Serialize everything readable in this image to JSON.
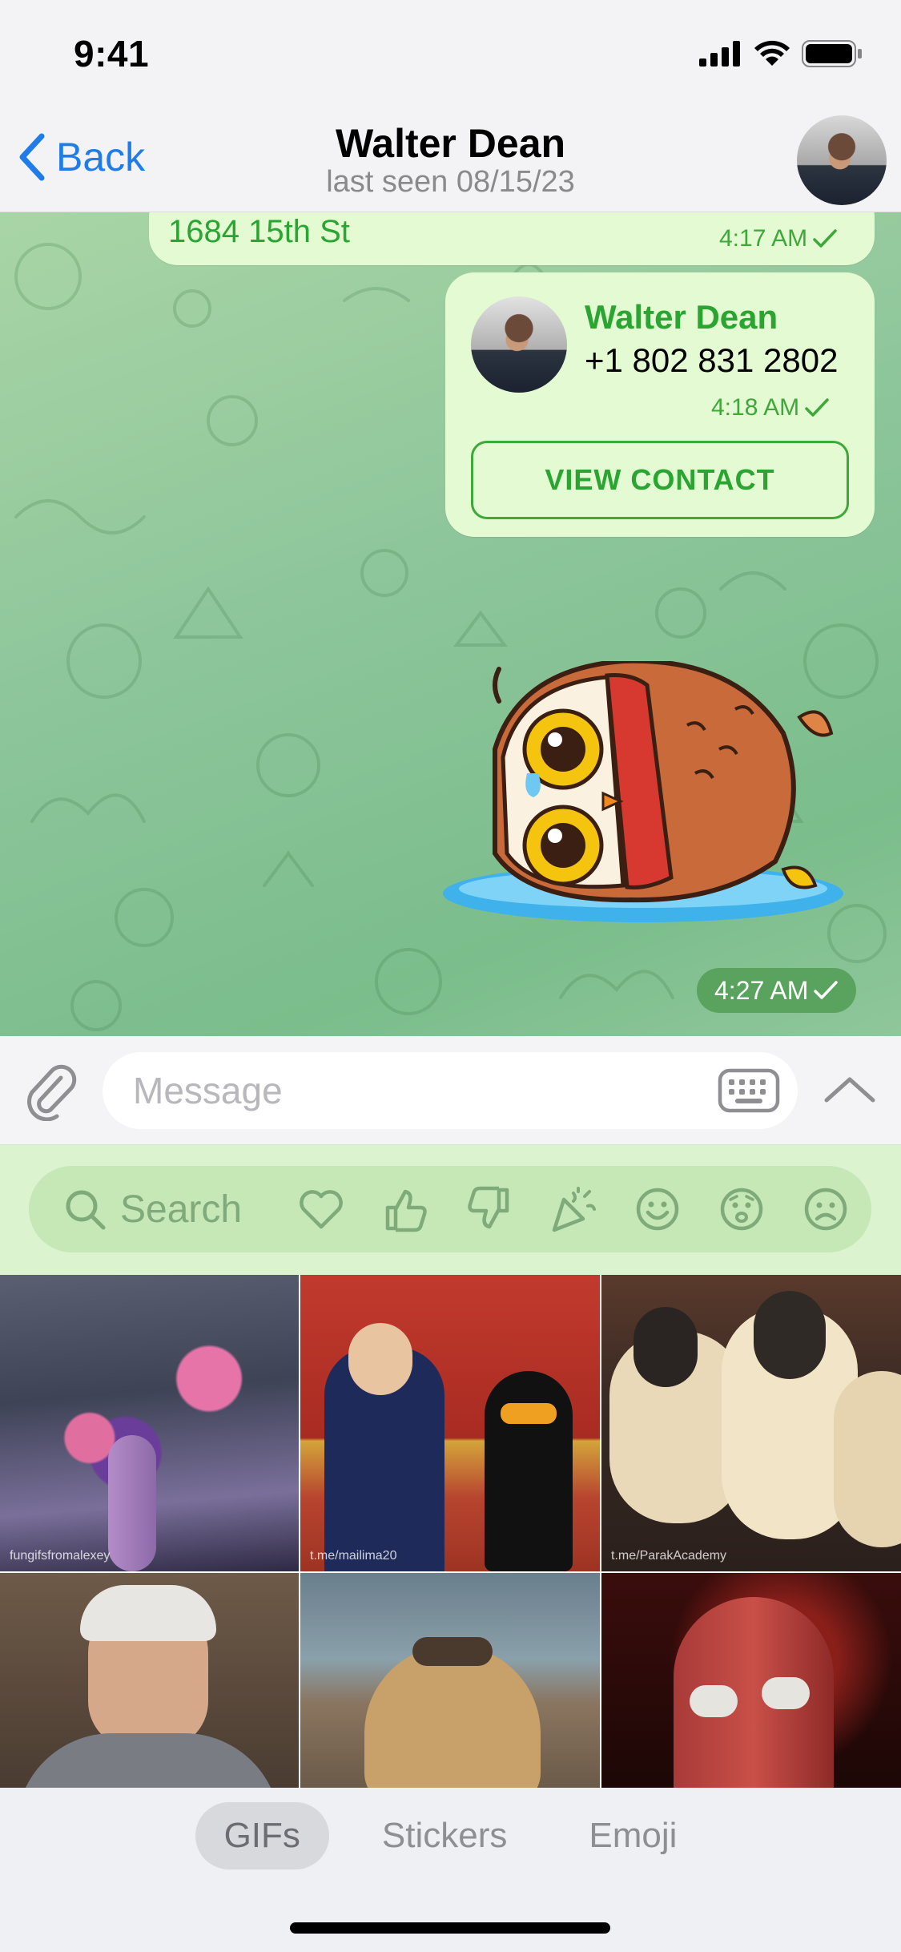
{
  "status_bar": {
    "time": "9:41"
  },
  "nav": {
    "back_label": "Back",
    "title": "Walter Dean",
    "subtitle": "last seen 08/15/23"
  },
  "messages": {
    "address": {
      "text": "1684 15th St",
      "time": "4:17 AM"
    },
    "contact": {
      "name": "Walter Dean",
      "phone": "+1 802 831 2802",
      "time": "4:18 AM",
      "button_label": "VIEW CONTACT"
    },
    "sticker": {
      "time": "4:27 AM"
    }
  },
  "composer": {
    "placeholder": "Message"
  },
  "gif_search": {
    "placeholder": "Search",
    "categories": [
      "heart",
      "thumbs-up",
      "thumbs-down",
      "party",
      "smile",
      "worried",
      "sad"
    ]
  },
  "gifs": [
    {
      "credit": "fungifsfromalexey"
    },
    {
      "credit": "t.me/mailima20"
    },
    {
      "credit": "t.me/ParakAcademy"
    },
    {
      "credit": ""
    },
    {
      "credit": ""
    },
    {
      "credit": ""
    }
  ],
  "tabs": [
    {
      "label": "GIFs",
      "active": true
    },
    {
      "label": "Stickers",
      "active": false
    },
    {
      "label": "Emoji",
      "active": false
    }
  ],
  "colors": {
    "accent_blue": "#1f7ce8",
    "bubble_green": "#e3fad2",
    "text_green": "#2aa531",
    "time_pill": "#5aa35f"
  }
}
